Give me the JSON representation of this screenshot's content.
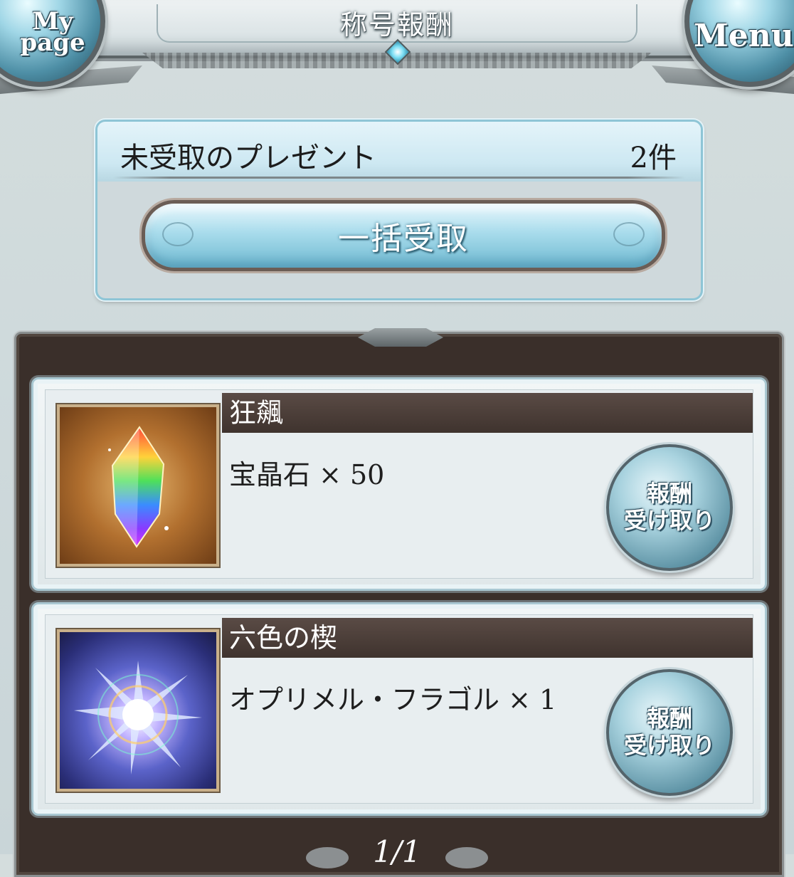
{
  "header": {
    "title": "称号報酬",
    "mypage_label_line1": "My",
    "mypage_label_line2": "page",
    "menu_label": "Menu"
  },
  "present": {
    "label": "未受取のプレゼント",
    "count": "2件",
    "claim_all_label": "一括受取"
  },
  "rewards": [
    {
      "title": "狂飆",
      "item": "宝晶石 × 50",
      "thumbnail_icon": "rainbow-crystal-icon",
      "claim_line1": "報酬",
      "claim_line2": "受け取り"
    },
    {
      "title": "六色の楔",
      "item": "オプリメル・フラゴル × 1",
      "thumbnail_icon": "prismatic-orb-icon",
      "claim_line1": "報酬",
      "claim_line2": "受け取り"
    }
  ],
  "pagination": {
    "text": "1/1"
  },
  "colors": {
    "accent_blue": "#8ec5d6",
    "frame_brown": "#3a2f2a",
    "title_bar": "#4c3f3a"
  }
}
